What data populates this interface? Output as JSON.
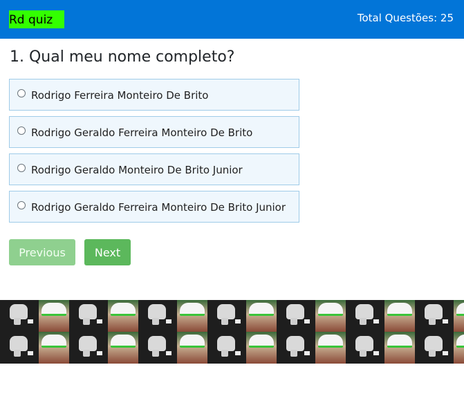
{
  "header": {
    "logo_text": "Rd quiz",
    "total_questions": "Total Questões: 25"
  },
  "question": {
    "text": "1. Qual meu nome completo?",
    "options": [
      {
        "label": "Rodrigo Ferreira Monteiro De Brito"
      },
      {
        "label": "Rodrigo Geraldo Ferreira Monteiro De Brito"
      },
      {
        "label": "Rodrigo Geraldo Monteiro De Brito Junior"
      },
      {
        "label": "Rodrigo Geraldo Ferreira Monteiro De Brito Junior"
      }
    ]
  },
  "navigation": {
    "previous_label": "Previous",
    "next_label": "Next"
  },
  "colors": {
    "header_bg": "#0275d8",
    "logo_bg": "#33ff00",
    "next_button": "#5cb85c",
    "previous_button_disabled": "#8fd08f",
    "option_bg": "#eff7fd",
    "option_border": "#9fcbe8"
  }
}
